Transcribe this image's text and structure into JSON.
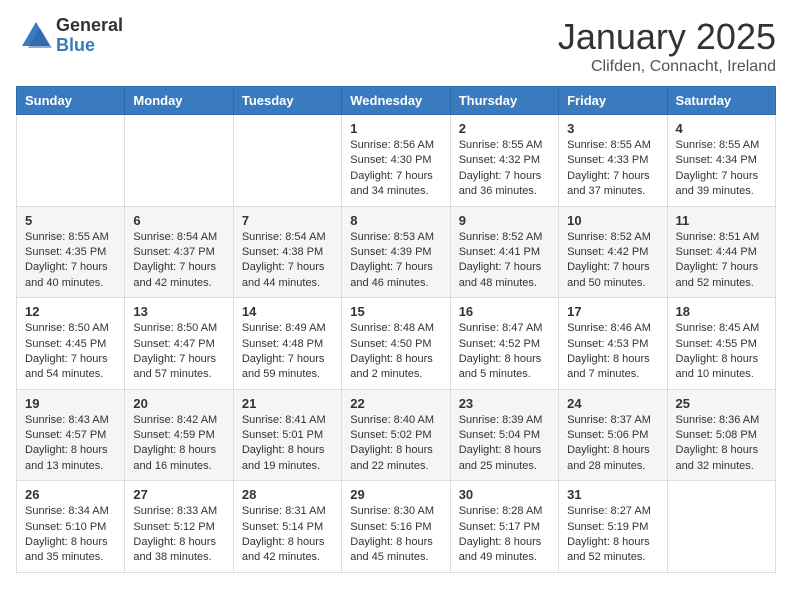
{
  "logo": {
    "general": "General",
    "blue": "Blue"
  },
  "title": "January 2025",
  "subtitle": "Clifden, Connacht, Ireland",
  "weekdays": [
    "Sunday",
    "Monday",
    "Tuesday",
    "Wednesday",
    "Thursday",
    "Friday",
    "Saturday"
  ],
  "weeks": [
    [
      {
        "day": "",
        "info": ""
      },
      {
        "day": "",
        "info": ""
      },
      {
        "day": "",
        "info": ""
      },
      {
        "day": "1",
        "info": "Sunrise: 8:56 AM\nSunset: 4:30 PM\nDaylight: 7 hours\nand 34 minutes."
      },
      {
        "day": "2",
        "info": "Sunrise: 8:55 AM\nSunset: 4:32 PM\nDaylight: 7 hours\nand 36 minutes."
      },
      {
        "day": "3",
        "info": "Sunrise: 8:55 AM\nSunset: 4:33 PM\nDaylight: 7 hours\nand 37 minutes."
      },
      {
        "day": "4",
        "info": "Sunrise: 8:55 AM\nSunset: 4:34 PM\nDaylight: 7 hours\nand 39 minutes."
      }
    ],
    [
      {
        "day": "5",
        "info": "Sunrise: 8:55 AM\nSunset: 4:35 PM\nDaylight: 7 hours\nand 40 minutes."
      },
      {
        "day": "6",
        "info": "Sunrise: 8:54 AM\nSunset: 4:37 PM\nDaylight: 7 hours\nand 42 minutes."
      },
      {
        "day": "7",
        "info": "Sunrise: 8:54 AM\nSunset: 4:38 PM\nDaylight: 7 hours\nand 44 minutes."
      },
      {
        "day": "8",
        "info": "Sunrise: 8:53 AM\nSunset: 4:39 PM\nDaylight: 7 hours\nand 46 minutes."
      },
      {
        "day": "9",
        "info": "Sunrise: 8:52 AM\nSunset: 4:41 PM\nDaylight: 7 hours\nand 48 minutes."
      },
      {
        "day": "10",
        "info": "Sunrise: 8:52 AM\nSunset: 4:42 PM\nDaylight: 7 hours\nand 50 minutes."
      },
      {
        "day": "11",
        "info": "Sunrise: 8:51 AM\nSunset: 4:44 PM\nDaylight: 7 hours\nand 52 minutes."
      }
    ],
    [
      {
        "day": "12",
        "info": "Sunrise: 8:50 AM\nSunset: 4:45 PM\nDaylight: 7 hours\nand 54 minutes."
      },
      {
        "day": "13",
        "info": "Sunrise: 8:50 AM\nSunset: 4:47 PM\nDaylight: 7 hours\nand 57 minutes."
      },
      {
        "day": "14",
        "info": "Sunrise: 8:49 AM\nSunset: 4:48 PM\nDaylight: 7 hours\nand 59 minutes."
      },
      {
        "day": "15",
        "info": "Sunrise: 8:48 AM\nSunset: 4:50 PM\nDaylight: 8 hours\nand 2 minutes."
      },
      {
        "day": "16",
        "info": "Sunrise: 8:47 AM\nSunset: 4:52 PM\nDaylight: 8 hours\nand 5 minutes."
      },
      {
        "day": "17",
        "info": "Sunrise: 8:46 AM\nSunset: 4:53 PM\nDaylight: 8 hours\nand 7 minutes."
      },
      {
        "day": "18",
        "info": "Sunrise: 8:45 AM\nSunset: 4:55 PM\nDaylight: 8 hours\nand 10 minutes."
      }
    ],
    [
      {
        "day": "19",
        "info": "Sunrise: 8:43 AM\nSunset: 4:57 PM\nDaylight: 8 hours\nand 13 minutes."
      },
      {
        "day": "20",
        "info": "Sunrise: 8:42 AM\nSunset: 4:59 PM\nDaylight: 8 hours\nand 16 minutes."
      },
      {
        "day": "21",
        "info": "Sunrise: 8:41 AM\nSunset: 5:01 PM\nDaylight: 8 hours\nand 19 minutes."
      },
      {
        "day": "22",
        "info": "Sunrise: 8:40 AM\nSunset: 5:02 PM\nDaylight: 8 hours\nand 22 minutes."
      },
      {
        "day": "23",
        "info": "Sunrise: 8:39 AM\nSunset: 5:04 PM\nDaylight: 8 hours\nand 25 minutes."
      },
      {
        "day": "24",
        "info": "Sunrise: 8:37 AM\nSunset: 5:06 PM\nDaylight: 8 hours\nand 28 minutes."
      },
      {
        "day": "25",
        "info": "Sunrise: 8:36 AM\nSunset: 5:08 PM\nDaylight: 8 hours\nand 32 minutes."
      }
    ],
    [
      {
        "day": "26",
        "info": "Sunrise: 8:34 AM\nSunset: 5:10 PM\nDaylight: 8 hours\nand 35 minutes."
      },
      {
        "day": "27",
        "info": "Sunrise: 8:33 AM\nSunset: 5:12 PM\nDaylight: 8 hours\nand 38 minutes."
      },
      {
        "day": "28",
        "info": "Sunrise: 8:31 AM\nSunset: 5:14 PM\nDaylight: 8 hours\nand 42 minutes."
      },
      {
        "day": "29",
        "info": "Sunrise: 8:30 AM\nSunset: 5:16 PM\nDaylight: 8 hours\nand 45 minutes."
      },
      {
        "day": "30",
        "info": "Sunrise: 8:28 AM\nSunset: 5:17 PM\nDaylight: 8 hours\nand 49 minutes."
      },
      {
        "day": "31",
        "info": "Sunrise: 8:27 AM\nSunset: 5:19 PM\nDaylight: 8 hours\nand 52 minutes."
      },
      {
        "day": "",
        "info": ""
      }
    ]
  ]
}
